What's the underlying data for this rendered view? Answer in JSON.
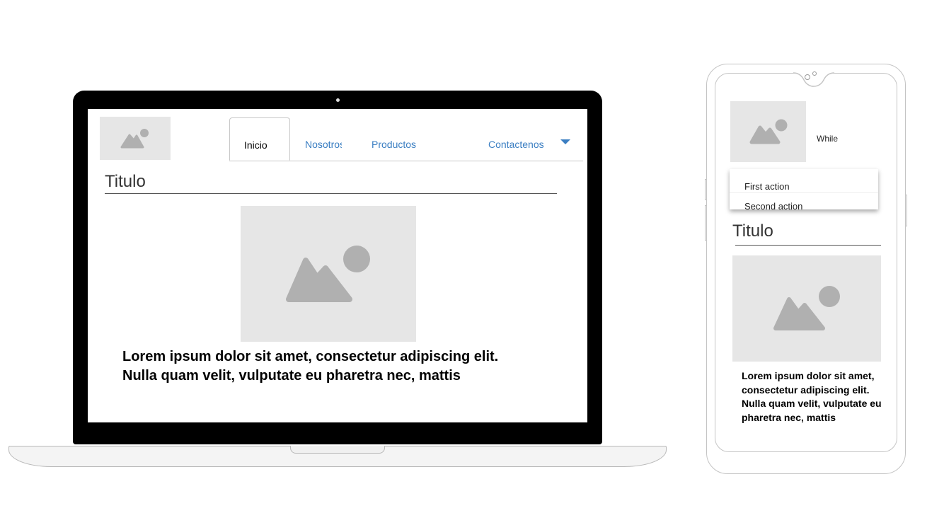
{
  "desktop": {
    "nav": {
      "tabs": [
        {
          "label": "Inicio",
          "active": true
        },
        {
          "label": "Nosotros"
        },
        {
          "label": "Productos"
        },
        {
          "label": "Contactenos"
        }
      ]
    },
    "title": "Titulo",
    "body": {
      "line1": "Lorem ipsum dolor sit amet, consectetur adipiscing elit.",
      "line2": "Nulla quam velit, vulputate eu pharetra nec, mattis"
    }
  },
  "mobile": {
    "header_label": "While",
    "dropdown": {
      "items": [
        "First action",
        "Second action"
      ]
    },
    "title": "Titulo",
    "body": "Lorem ipsum dolor sit amet, consectetur adipiscing elit. Nulla quam velit, vulputate eu pharetra nec, mattis"
  },
  "colors": {
    "accent": "#3a7ec2",
    "placeholder_bg": "#e6e6e6",
    "placeholder_icon": "#b0b0b0"
  },
  "icons": [
    "image-placeholder-icon",
    "chevron-down-icon"
  ]
}
